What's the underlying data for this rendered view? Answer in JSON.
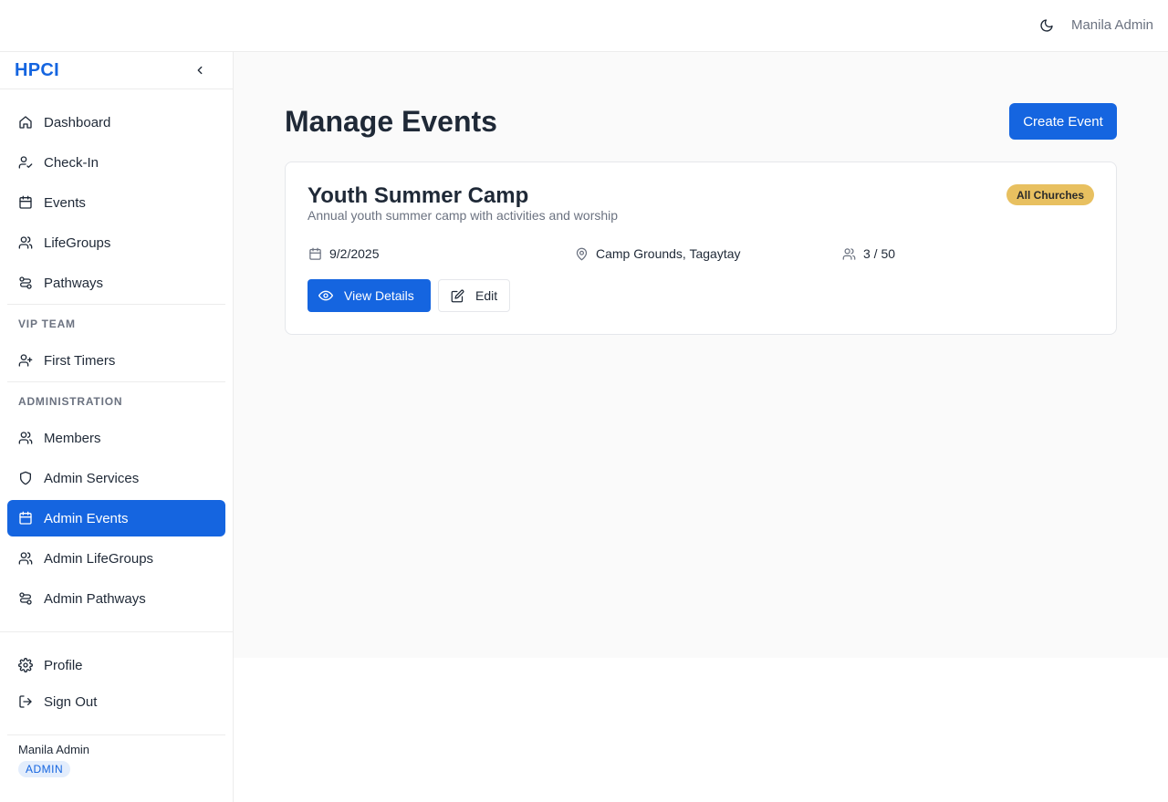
{
  "topbar": {
    "theme_icon": "moon-icon",
    "user_name": "Manila Admin"
  },
  "sidebar": {
    "brand": "HPCI",
    "main_items": [
      {
        "label": "Dashboard",
        "icon": "home-icon"
      },
      {
        "label": "Check-In",
        "icon": "user-check-icon"
      },
      {
        "label": "Events",
        "icon": "calendar-icon"
      },
      {
        "label": "LifeGroups",
        "icon": "users-icon"
      },
      {
        "label": "Pathways",
        "icon": "route-icon"
      }
    ],
    "vip_label": "VIP TEAM",
    "vip_items": [
      {
        "label": "First Timers",
        "icon": "user-plus-icon"
      }
    ],
    "admin_label": "ADMINISTRATION",
    "admin_items": [
      {
        "label": "Members",
        "icon": "users-icon"
      },
      {
        "label": "Admin Services",
        "icon": "shield-icon"
      },
      {
        "label": "Admin Events",
        "icon": "calendar-icon",
        "active": true
      },
      {
        "label": "Admin LifeGroups",
        "icon": "users-icon"
      },
      {
        "label": "Admin Pathways",
        "icon": "route-icon"
      }
    ],
    "footer_items": [
      {
        "label": "Profile",
        "icon": "gear-icon"
      },
      {
        "label": "Sign Out",
        "icon": "sign-out-icon"
      }
    ],
    "user_name": "Manila Admin",
    "user_role": "ADMIN"
  },
  "main": {
    "title": "Manage Events",
    "create_label": "Create Event",
    "events": [
      {
        "title": "Youth Summer Camp",
        "description": "Annual youth summer camp with activities and worship",
        "scope": "All Churches",
        "date": "9/2/2025",
        "location": "Camp Grounds, Tagaytay",
        "capacity": "3 / 50",
        "view_label": "View Details",
        "edit_label": "Edit"
      }
    ]
  },
  "colors": {
    "accent": "#1565e0",
    "badge": "#e8c060",
    "role_badge_bg": "#e3edfc"
  }
}
